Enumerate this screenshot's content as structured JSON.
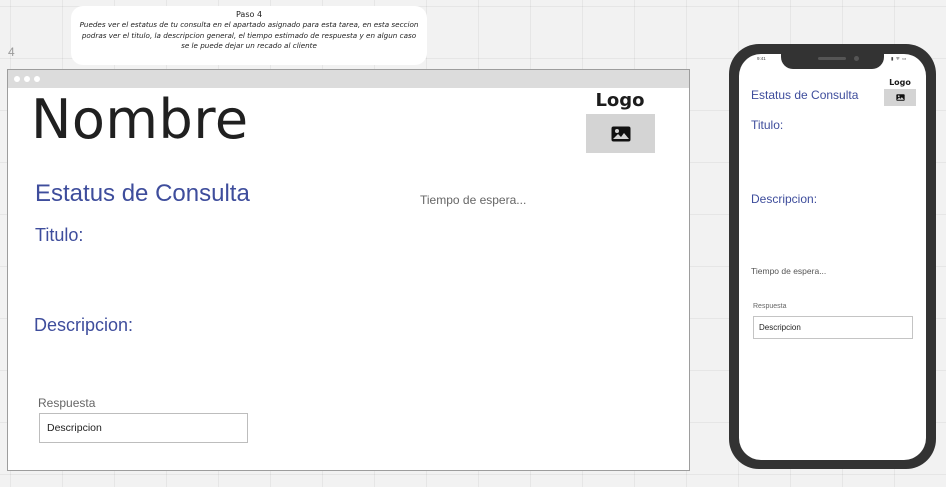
{
  "note": {
    "step": "Paso 4",
    "description": "Puedes ver el estatus de tu consulta en el apartado asignado para esta tarea, en esta seccion podras ver el titulo, la descripcion general, el tiempo estimado de respuesta y en algun caso se le puede dejar un recado al cliente"
  },
  "step_number": "4",
  "desktop": {
    "name": "Nombre",
    "logo_label": "Logo",
    "status_heading": "Estatus de Consulta",
    "wait_time": "Tiempo de espera...",
    "title_label": "Titulo:",
    "description_label": "Descripcion:",
    "response_label": "Respuesta",
    "response_value": "Descripcion"
  },
  "mobile": {
    "time": "9:41",
    "status_icons": "▮ ᯤ ▭",
    "logo_label": "Logo",
    "status_heading": "Estatus de Consulta",
    "title_label": "Titulo:",
    "description_label": "Descripcion:",
    "wait_time": "Tiempo de espera...",
    "response_label": "Respuesta",
    "response_value": "Descripcion"
  },
  "colors": {
    "accent": "#3e4d9c",
    "canvas": "#f2f2f2",
    "placeholder": "#d4d4d4",
    "phone_frame": "#333333"
  },
  "icons": {
    "logo_placeholder": "image-icon"
  }
}
